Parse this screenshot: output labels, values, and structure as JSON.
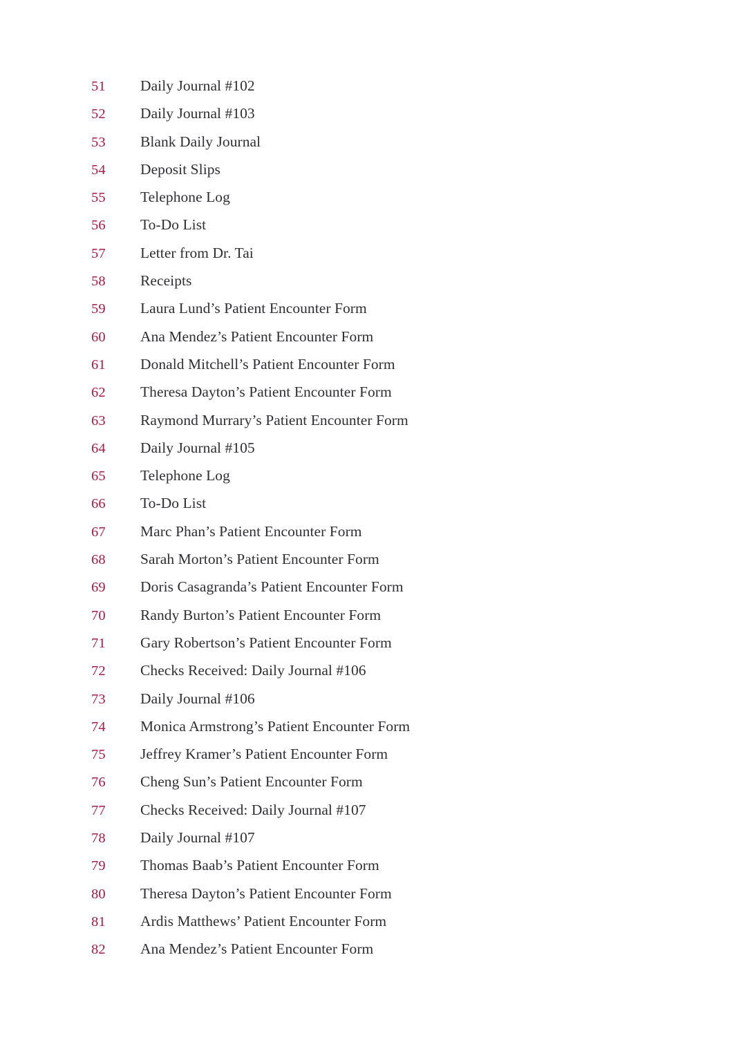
{
  "document": {
    "type": "index-list",
    "page_background": "#ffffff",
    "number_color": "#a61b44",
    "text_color": "#2f2f33",
    "first_number": 51,
    "last_number": 82,
    "entry_count": 32
  },
  "entries": [
    {
      "number": "51",
      "label": "Daily Journal #102"
    },
    {
      "number": "52",
      "label": "Daily Journal #103"
    },
    {
      "number": "53",
      "label": "Blank Daily Journal"
    },
    {
      "number": "54",
      "label": "Deposit Slips"
    },
    {
      "number": "55",
      "label": "Telephone Log"
    },
    {
      "number": "56",
      "label": "To-Do List"
    },
    {
      "number": "57",
      "label": "Letter from Dr. Tai"
    },
    {
      "number": "58",
      "label": "Receipts"
    },
    {
      "number": "59",
      "label": "Laura Lund’s Patient Encounter Form"
    },
    {
      "number": "60",
      "label": "Ana Mendez’s Patient Encounter Form"
    },
    {
      "number": "61",
      "label": "Donald Mitchell’s Patient Encounter Form"
    },
    {
      "number": "62",
      "label": "Theresa Dayton’s Patient Encounter Form"
    },
    {
      "number": "63",
      "label": "Raymond Murrary’s Patient Encounter Form"
    },
    {
      "number": "64",
      "label": "Daily Journal #105"
    },
    {
      "number": "65",
      "label": "Telephone Log"
    },
    {
      "number": "66",
      "label": "To-Do List"
    },
    {
      "number": "67",
      "label": "Marc Phan’s Patient Encounter Form"
    },
    {
      "number": "68",
      "label": "Sarah Morton’s Patient Encounter Form"
    },
    {
      "number": "69",
      "label": "Doris Casagranda’s Patient Encounter Form"
    },
    {
      "number": "70",
      "label": "Randy Burton’s Patient Encounter Form"
    },
    {
      "number": "71",
      "label": "Gary Robertson’s Patient Encounter Form"
    },
    {
      "number": "72",
      "label": "Checks Received: Daily Journal #106"
    },
    {
      "number": "73",
      "label": "Daily Journal #106"
    },
    {
      "number": "74",
      "label": "Monica Armstrong’s Patient Encounter Form"
    },
    {
      "number": "75",
      "label": "Jeffrey Kramer’s Patient Encounter Form"
    },
    {
      "number": "76",
      "label": "Cheng Sun’s Patient Encounter Form"
    },
    {
      "number": "77",
      "label": "Checks Received: Daily Journal #107"
    },
    {
      "number": "78",
      "label": "Daily Journal #107"
    },
    {
      "number": "79",
      "label": "Thomas Baab’s Patient Encounter Form"
    },
    {
      "number": "80",
      "label": "Theresa Dayton’s Patient Encounter Form"
    },
    {
      "number": "81",
      "label": "Ardis Matthews’ Patient Encounter Form"
    },
    {
      "number": "82",
      "label": "Ana Mendez’s Patient Encounter Form"
    }
  ]
}
